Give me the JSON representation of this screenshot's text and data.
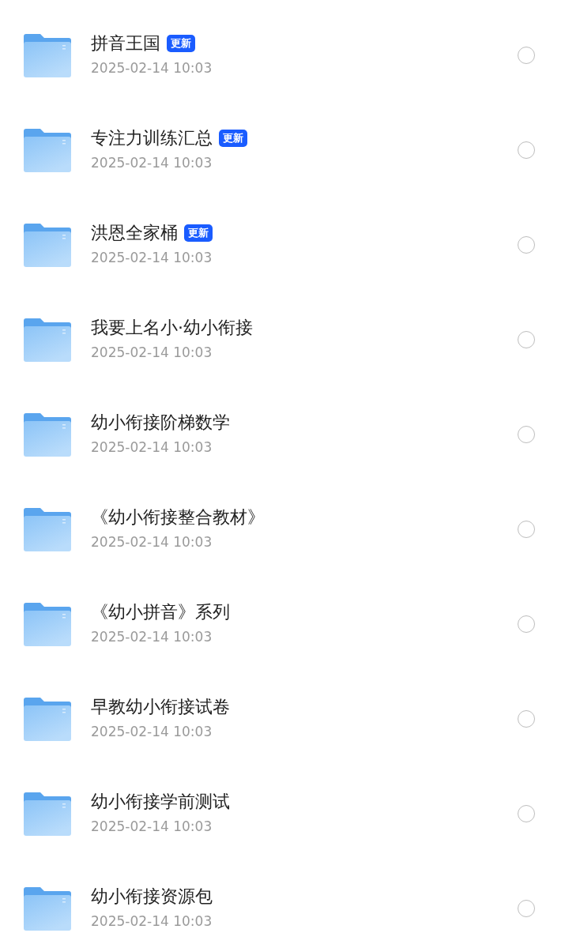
{
  "files": [
    {
      "name": "拼音王国",
      "badge": "更新",
      "date": "2025-02-14 10:03",
      "selected": false
    },
    {
      "name": "专注力训练汇总",
      "badge": "更新",
      "date": "2025-02-14 10:03",
      "selected": false
    },
    {
      "name": "洪恩全家桶",
      "badge": "更新",
      "date": "2025-02-14 10:03",
      "selected": false
    },
    {
      "name": "我要上名小·幼小衔接",
      "date": "2025-02-14 10:03",
      "selected": false
    },
    {
      "name": "幼小衔接阶梯数学",
      "date": "2025-02-14 10:03",
      "selected": false
    },
    {
      "name": "《幼小衔接整合教材》",
      "date": "2025-02-14 10:03",
      "selected": false
    },
    {
      "name": "《幼小拼音》系列",
      "date": "2025-02-14 10:03",
      "selected": false
    },
    {
      "name": "早教幼小衔接试卷",
      "date": "2025-02-14 10:03",
      "selected": false
    },
    {
      "name": "幼小衔接学前测试",
      "date": "2025-02-14 10:03",
      "selected": false
    },
    {
      "name": "幼小衔接资源包",
      "date": "2025-02-14 10:03",
      "selected": false
    }
  ]
}
